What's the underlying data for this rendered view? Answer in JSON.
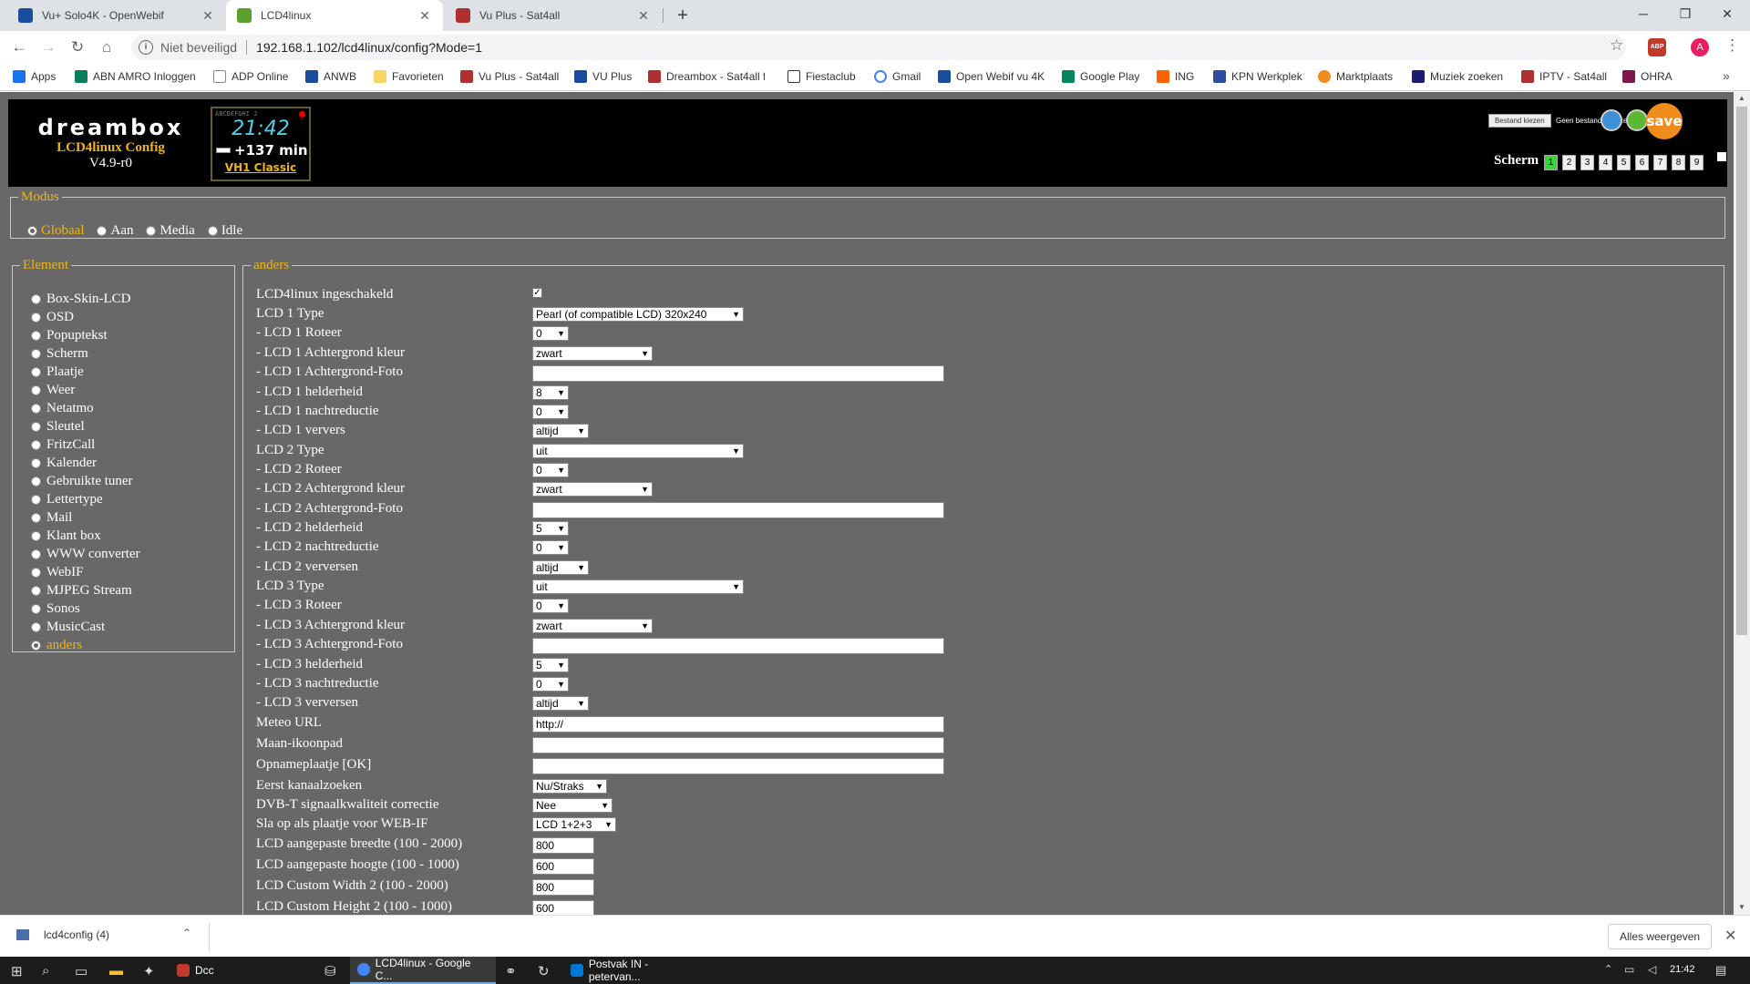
{
  "browser": {
    "tabs": [
      {
        "label": "Vu+ Solo4K - OpenWebif",
        "color": "#1a4d9e"
      },
      {
        "label": "LCD4linux",
        "color": "#5aa02c"
      },
      {
        "label": "Vu Plus - Sat4all",
        "color": "#b03030"
      }
    ],
    "address": {
      "security": "Niet beveiligd",
      "url": "192.168.1.102/lcd4linux/config?Mode=1"
    },
    "profile_initial": "A",
    "adblock_label": "ABP",
    "bookmarks": [
      {
        "label": "Apps",
        "color": "#1a73e8"
      },
      {
        "label": "ABN AMRO Inloggen",
        "color": "#0a7f5e"
      },
      {
        "label": "ADP Online",
        "color": "#cccccc"
      },
      {
        "label": "ANWB",
        "color": "#f5b800"
      },
      {
        "label": "Favorieten",
        "color": "#f7d560"
      },
      {
        "label": "Vu Plus - Sat4all",
        "color": "#b03030"
      },
      {
        "label": "VU Plus",
        "color": "#1a4d9e"
      },
      {
        "label": "Dreambox - Sat4all fo...",
        "color": "#b03030"
      },
      {
        "label": "Fiestaclub",
        "color": "#333333"
      },
      {
        "label": "Gmail",
        "color": "#4285f4"
      },
      {
        "label": "Open Webif vu 4K",
        "color": "#1a4d9e"
      },
      {
        "label": "Google Play",
        "color": "#01875f"
      },
      {
        "label": "ING",
        "color": "#ff6200"
      },
      {
        "label": "KPN Werkplek",
        "color": "#2c4da0"
      },
      {
        "label": "Marktplaats",
        "color": "#f08c1b"
      },
      {
        "label": "Muziek zoeken",
        "color": "#1a1a6e"
      },
      {
        "label": "IPTV - Sat4all",
        "color": "#b03030"
      },
      {
        "label": "OHRA",
        "color": "#7a1a4a"
      }
    ]
  },
  "header": {
    "logo": "dreambox",
    "app_title": "LCD4linux Config",
    "version": "V4.9-r0",
    "preview": {
      "top_text": "ABCDEFGHI J",
      "time": "21:42",
      "minutes": "+137 min",
      "channel": "VH1 Classic"
    },
    "file_button": "Bestand kiezen",
    "file_status": "Geen bestand gekozen",
    "save_label": "save",
    "scherm_label": "Scherm",
    "scherm_buttons": [
      "1",
      "2",
      "3",
      "4",
      "5",
      "6",
      "7",
      "8",
      "9"
    ],
    "scherm_active": "1"
  },
  "modus": {
    "legend": "Modus",
    "options": [
      "Globaal",
      "Aan",
      "Media",
      "Idle"
    ],
    "selected": "Globaal"
  },
  "element": {
    "legend": "Element",
    "items": [
      "Box-Skin-LCD",
      "OSD",
      "Popuptekst",
      "Scherm",
      "Plaatje",
      "Weer",
      "Netatmo",
      "Sleutel",
      "FritzCall",
      "Kalender",
      "Gebruikte tuner",
      "Lettertype",
      "Mail",
      "Klant box",
      "WWW converter",
      "WebIF",
      "MJPEG Stream",
      "Sonos",
      "MusicCast",
      "anders"
    ],
    "selected": "anders"
  },
  "settings": {
    "legend": "anders",
    "rows": [
      {
        "label": "LCD4linux ingeschakeld",
        "type": "checkbox",
        "checked": true
      },
      {
        "label": "LCD 1 Type",
        "type": "select",
        "value": "Pearl (of compatible LCD) 320x240"
      },
      {
        "label": "- LCD 1 Roteer",
        "type": "select",
        "value": "0"
      },
      {
        "label": "- LCD 1 Achtergrond kleur",
        "type": "select",
        "value": "zwart"
      },
      {
        "label": "- LCD 1 Achtergrond-Foto",
        "type": "text",
        "value": ""
      },
      {
        "label": "- LCD 1 helderheid",
        "type": "select",
        "value": "8"
      },
      {
        "label": "- LCD 1 nachtreductie",
        "type": "select",
        "value": "0"
      },
      {
        "label": "- LCD 1 ververs",
        "type": "select",
        "value": "altijd"
      },
      {
        "label": "LCD 2 Type",
        "type": "select",
        "value": "uit"
      },
      {
        "label": "- LCD 2 Roteer",
        "type": "select",
        "value": "0"
      },
      {
        "label": "- LCD 2 Achtergrond kleur",
        "type": "select",
        "value": "zwart"
      },
      {
        "label": "- LCD 2 Achtergrond-Foto",
        "type": "text",
        "value": ""
      },
      {
        "label": "- LCD 2 helderheid",
        "type": "select",
        "value": "5"
      },
      {
        "label": "- LCD 2 nachtreductie",
        "type": "select",
        "value": "0"
      },
      {
        "label": "- LCD 2 verversen",
        "type": "select",
        "value": "altijd"
      },
      {
        "label": "LCD 3 Type",
        "type": "select",
        "value": "uit"
      },
      {
        "label": "- LCD 3 Roteer",
        "type": "select",
        "value": "0"
      },
      {
        "label": "- LCD 3 Achtergrond kleur",
        "type": "select",
        "value": "zwart"
      },
      {
        "label": "- LCD 3 Achtergrond-Foto",
        "type": "text",
        "value": ""
      },
      {
        "label": "- LCD 3 helderheid",
        "type": "select",
        "value": "5"
      },
      {
        "label": "- LCD 3 nachtreductie",
        "type": "select",
        "value": "0"
      },
      {
        "label": "- LCD 3 verversen",
        "type": "select",
        "value": "altijd"
      },
      {
        "label": "Meteo URL",
        "type": "text",
        "value": "http://"
      },
      {
        "label": "Maan-ikoonpad",
        "type": "text",
        "value": ""
      },
      {
        "label": "Opnameplaatje [OK]",
        "type": "text",
        "value": ""
      },
      {
        "label": "Eerst kanaalzoeken",
        "type": "select",
        "value": "Nu/Straks"
      },
      {
        "label": "DVB-T signaalkwaliteit correctie",
        "type": "select",
        "value": "Nee"
      },
      {
        "label": "Sla op als plaatje voor WEB-IF",
        "type": "select",
        "value": "LCD 1+2+3"
      },
      {
        "label": "LCD aangepaste breedte (100 - 2000)",
        "type": "number",
        "value": "800"
      },
      {
        "label": "LCD aangepaste hoogte (100 - 1000)",
        "type": "number",
        "value": "600"
      },
      {
        "label": "LCD Custom Width 2 (100 - 2000)",
        "type": "number",
        "value": "800"
      },
      {
        "label": "LCD Custom Height 2 (100 - 1000)",
        "type": "number",
        "value": "600"
      }
    ]
  },
  "downloads": {
    "item": "lcd4config (4)",
    "show_all": "Alles weergeven"
  },
  "taskbar": {
    "apps": [
      {
        "label": "Dcc",
        "color": "#c0392b"
      },
      {
        "label": "LCD4linux - Google C...",
        "color": "#4285f4"
      },
      {
        "label": "Postvak IN - petervan...",
        "color": "#0078d4"
      }
    ],
    "time": "21:42"
  }
}
